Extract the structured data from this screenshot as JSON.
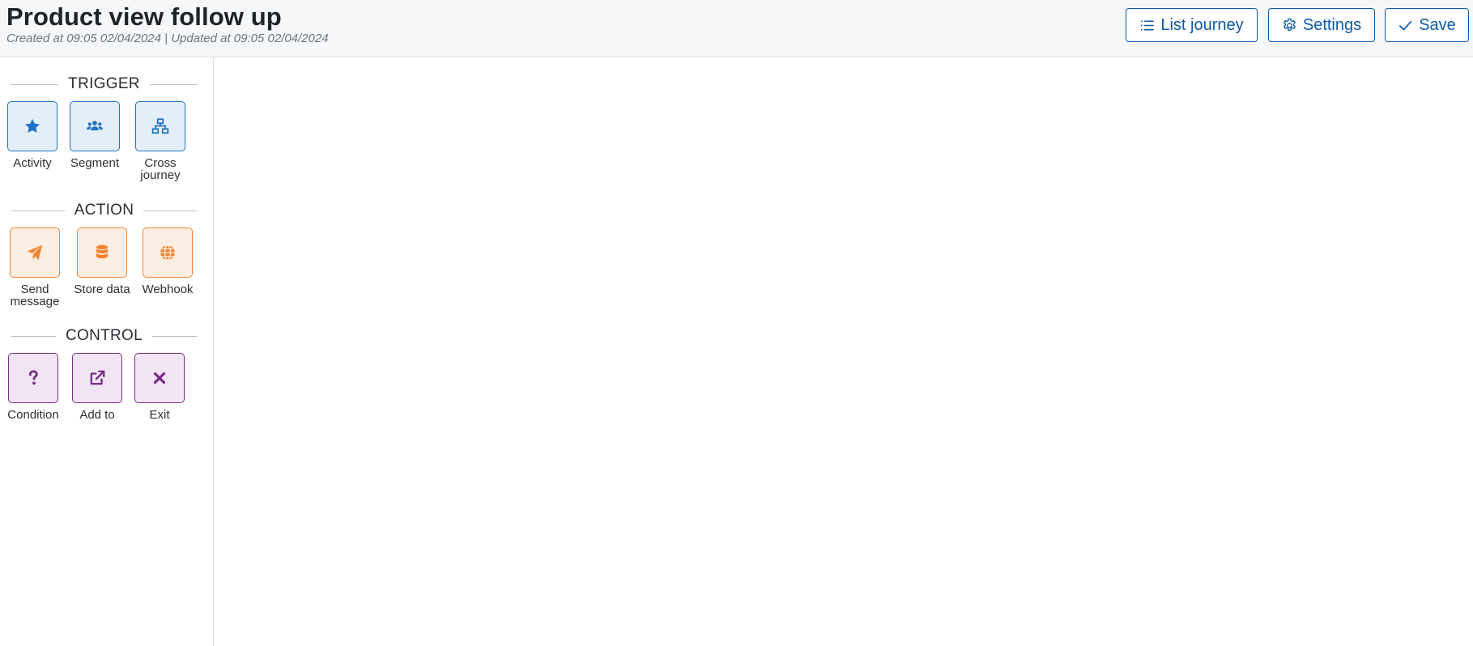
{
  "header": {
    "title": "Product view follow up",
    "meta": "Created at 09:05 02/04/2024 | Updated at 09:05 02/04/2024",
    "buttons": {
      "list_journey": "List journey",
      "settings": "Settings",
      "save": "Save"
    }
  },
  "sidebar": {
    "trigger": {
      "title": "TRIGGER",
      "items": [
        {
          "label": "Activity",
          "icon": "star-icon"
        },
        {
          "label": "Segment",
          "icon": "users-icon"
        },
        {
          "label": "Cross journey",
          "icon": "sitemap-icon"
        }
      ]
    },
    "action": {
      "title": "ACTION",
      "items": [
        {
          "label": "Send message",
          "icon": "paper-plane-icon"
        },
        {
          "label": "Store data",
          "icon": "database-icon"
        },
        {
          "label": "Webhook",
          "icon": "globe-icon"
        }
      ]
    },
    "control": {
      "title": "CONTROL",
      "items": [
        {
          "label": "Condition",
          "icon": "question-icon"
        },
        {
          "label": "Add to",
          "icon": "external-link-icon"
        },
        {
          "label": "Exit",
          "icon": "close-icon"
        }
      ]
    }
  },
  "colors": {
    "primary": "#0d5aa7",
    "trigger": "#1f72c4",
    "action": "#f2842f",
    "control": "#7a2a87"
  }
}
